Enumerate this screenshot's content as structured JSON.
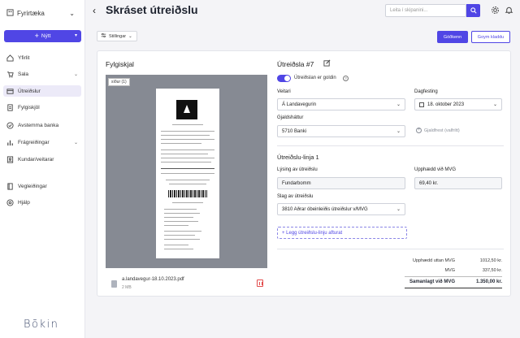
{
  "sidebar": {
    "company": "Fyrirtæka",
    "new_button": "Nýtt",
    "items": [
      {
        "label": "Yfirlit",
        "icon": "home-icon"
      },
      {
        "label": "Sala",
        "icon": "cart-icon"
      },
      {
        "label": "Útreiðslur",
        "icon": "card-icon"
      },
      {
        "label": "Fylgiskjöl",
        "icon": "document-icon"
      },
      {
        "label": "Avstemma banka",
        "icon": "check-circle-icon"
      },
      {
        "label": "Frágreiðingar",
        "icon": "report-icon"
      },
      {
        "label": "Kundar/veitarar",
        "icon": "contacts-icon"
      },
      {
        "label": "Vegleiðingar",
        "icon": "book-icon"
      },
      {
        "label": "Hjálp",
        "icon": "help-icon"
      }
    ],
    "brand": "Bōkin"
  },
  "header": {
    "title": "Skráset útreiðslu",
    "search_placeholder": "Leita í skipanini..."
  },
  "toolbar": {
    "settings": "Stillingar",
    "approve": "Góðkenn",
    "save_draft": "Goym kladdu"
  },
  "attachment": {
    "title": "Fylgiskjal",
    "page_tag": "síður (1)",
    "file_name": "a.landavegur-18.10.2023.pdf",
    "file_size": "2 MB"
  },
  "expense": {
    "title": "Útreiðsla #7",
    "paid_toggle": "Útreiðslan er goldin",
    "supplier_label": "Veitari",
    "supplier_value": "Á Landavegurin",
    "date_label": "Dagfesting",
    "date_value": "18. oktober 2023",
    "payment_label": "Gjaldsháttur",
    "payment_value": "5710 Banki",
    "add_fee": "Gjaldfrest (valfrítt)"
  },
  "line": {
    "title": "Útreiðslu-linja 1",
    "desc_label": "Lýsing av útreiðslu",
    "desc_value": "Fundarbomm",
    "amount_label": "Upphædd við MVG",
    "amount_value": "69,40 kr.",
    "type_label": "Slag av útreiðslu",
    "type_value": "3810 Aðrar óbeinleiðis útreiðslur v/MVG",
    "add_line": "+ Legg útreiðslu-linju afturat"
  },
  "totals": {
    "excl_label": "Upphædd uttan MVG",
    "excl_value": "1012,50 kr.",
    "vat_label": "MVG",
    "vat_value": "337,50 kr.",
    "total_label": "Samanlagt við MVG",
    "total_value": "1.350,00 kr."
  }
}
